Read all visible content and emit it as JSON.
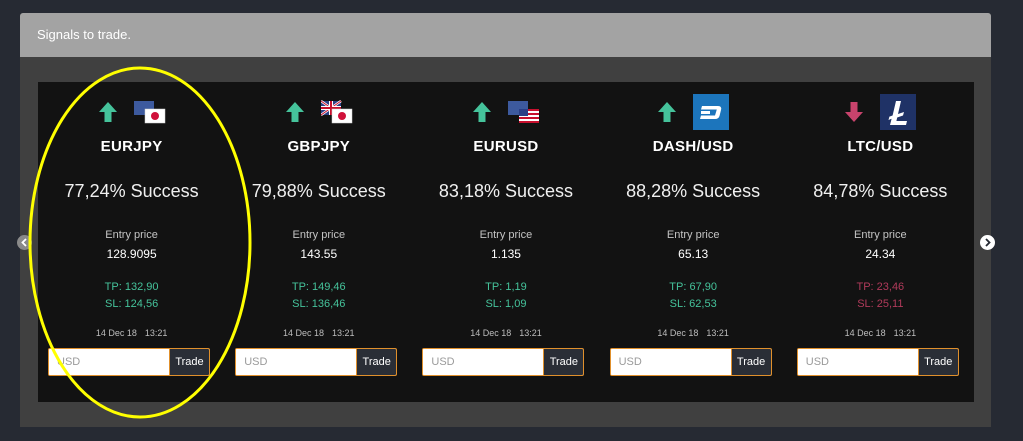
{
  "panel": {
    "title": "Signals to trade."
  },
  "signals": [
    {
      "direction": "up",
      "pair": "EURJPY",
      "icon_left": "euro-flag",
      "icon_right": "japan-flag",
      "success": "77,24% Success",
      "entry_label": "Entry price",
      "entry_price": "128.9095",
      "tp": "TP: 132,90",
      "sl": "SL: 124,56",
      "date": "14 Dec 18",
      "time": "13:21",
      "input_placeholder": "USD",
      "trade_label": "Trade"
    },
    {
      "direction": "up",
      "pair": "GBPJPY",
      "icon_left": "uk-flag",
      "icon_right": "japan-flag",
      "success": "79,88% Success",
      "entry_label": "Entry price",
      "entry_price": "143.55",
      "tp": "TP: 149,46",
      "sl": "SL: 136,46",
      "date": "14 Dec 18",
      "time": "13:21",
      "input_placeholder": "USD",
      "trade_label": "Trade"
    },
    {
      "direction": "up",
      "pair": "EURUSD",
      "icon_left": "euro-flag",
      "icon_right": "us-flag",
      "success": "83,18% Success",
      "entry_label": "Entry price",
      "entry_price": "1.135",
      "tp": "TP: 1,19",
      "sl": "SL: 1,09",
      "date": "14 Dec 18",
      "time": "13:21",
      "input_placeholder": "USD",
      "trade_label": "Trade"
    },
    {
      "direction": "up",
      "pair": "DASH/USD",
      "icon_left": "dash-coin",
      "icon_right": "",
      "success": "88,28% Success",
      "entry_label": "Entry price",
      "entry_price": "65.13",
      "tp": "TP: 67,90",
      "sl": "SL: 62,53",
      "date": "14 Dec 18",
      "time": "13:21",
      "input_placeholder": "USD",
      "trade_label": "Trade"
    },
    {
      "direction": "down",
      "pair": "LTC/USD",
      "icon_left": "litecoin-coin",
      "icon_right": "",
      "success": "84,78% Success",
      "entry_label": "Entry price",
      "entry_price": "24.34",
      "tp": "TP: 23,46",
      "sl": "SL: 25,11",
      "date": "14 Dec 18",
      "time": "13:21",
      "input_placeholder": "USD",
      "trade_label": "Trade"
    }
  ],
  "navigation": {
    "prev_icon": "chevron-left-icon",
    "next_icon": "chevron-right-icon"
  },
  "colors": {
    "up": "#45c39b",
    "down": "#c8436c",
    "accent_border": "#e0902c",
    "annotation": "#ffff00"
  }
}
